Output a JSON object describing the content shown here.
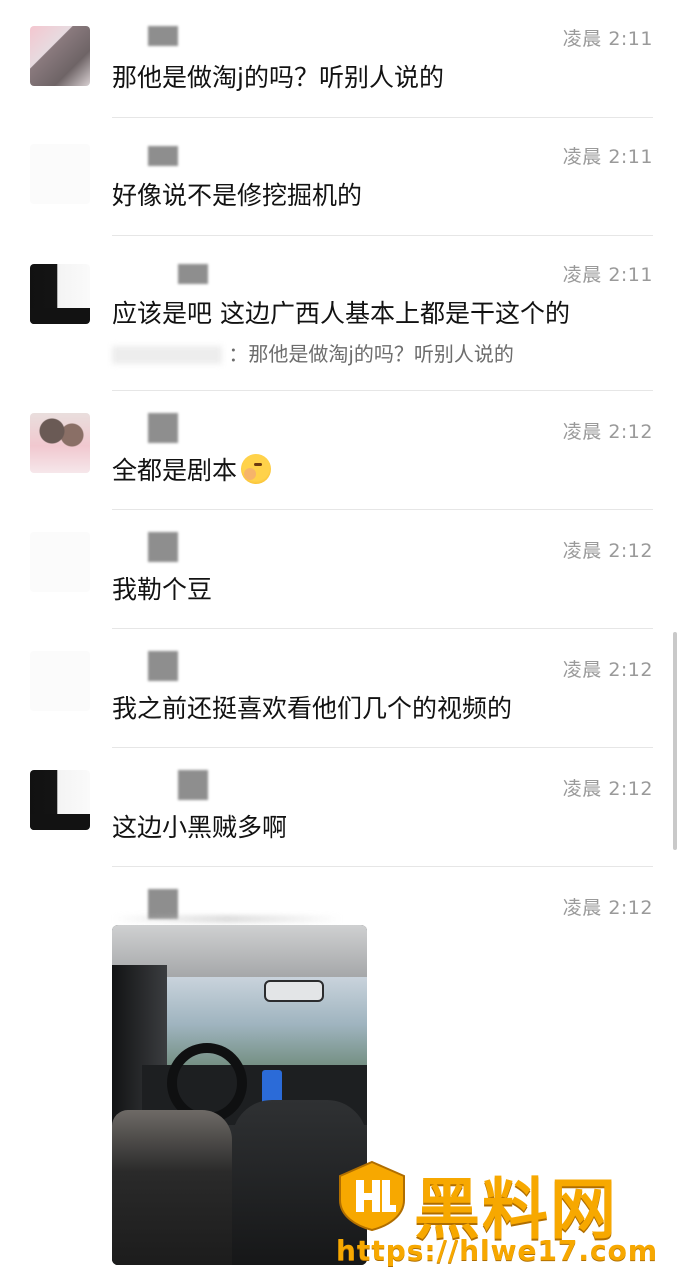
{
  "messages": [
    {
      "time": "凌晨 2:11",
      "text": "那他是做淘j的吗？听别人说的"
    },
    {
      "time": "凌晨 2:11",
      "text": "好像说不是修挖掘机的"
    },
    {
      "time": "凌晨 2:11",
      "text": "应该是吧 这边广西人基本上都是干这个的",
      "quote": "：那他是做淘j的吗？听别人说的"
    },
    {
      "time": "凌晨 2:12",
      "text": "全都是剧本"
    },
    {
      "time": "凌晨 2:12",
      "text": "我勒个豆"
    },
    {
      "time": "凌晨 2:12",
      "text": "我之前还挺喜欢看他们几个的视频的"
    },
    {
      "time": "凌晨 2:12",
      "text": "这边小黑贼多啊"
    },
    {
      "time": "凌晨 2:12"
    }
  ],
  "watermark": {
    "title": "黑料网",
    "url": "https://hlwe17.com",
    "color": "#f7a800"
  },
  "icons": {
    "emoji": "face-with-tears-of-joy-emoji",
    "watermark_logo": "hl-shield-logo"
  }
}
